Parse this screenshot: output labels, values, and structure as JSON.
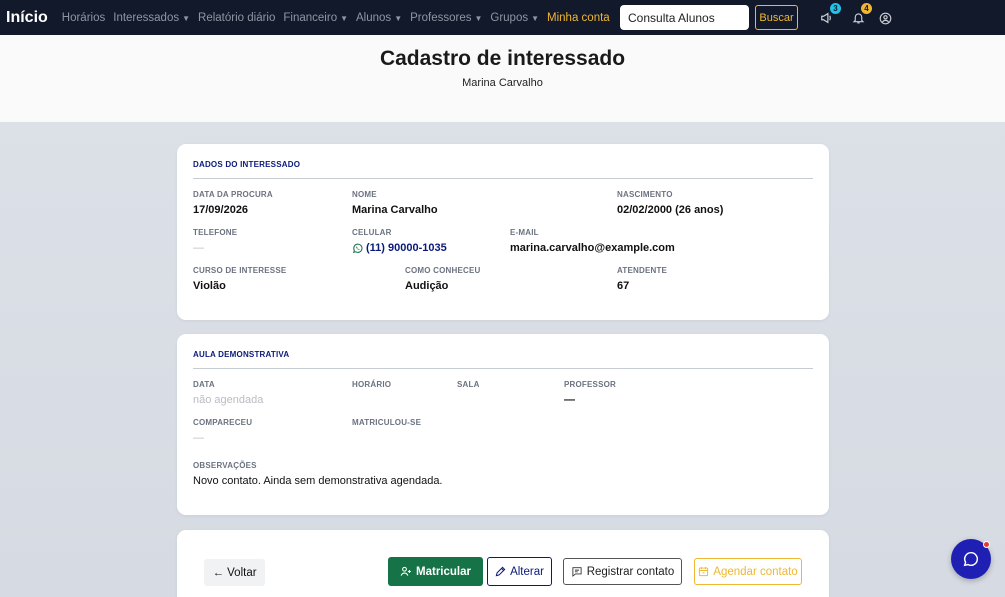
{
  "nav": {
    "brand": "Início",
    "items": [
      {
        "label": "Horários",
        "dropdown": false
      },
      {
        "label": "Interessados",
        "dropdown": true
      },
      {
        "label": "Relatório diário",
        "dropdown": false
      },
      {
        "label": "Financeiro",
        "dropdown": true
      },
      {
        "label": "Alunos",
        "dropdown": true
      },
      {
        "label": "Professores",
        "dropdown": true
      },
      {
        "label": "Grupos",
        "dropdown": true
      }
    ],
    "account_label": "Minha conta",
    "search_value": "Consulta Alunos",
    "search_button": "Buscar",
    "megaphone_badge": "3",
    "bell_badge": "4",
    "megaphone_badge_color": "#22c3e6",
    "bell_badge_color": "#f0b732",
    "icons": [
      "megaphone-icon",
      "bell-icon",
      "user-icon"
    ]
  },
  "header": {
    "title": "Cadastro de interessado",
    "subtitle": "Marina Carvalho"
  },
  "interested": {
    "section_title": "DADOS DO INTERESSADO",
    "fields": {
      "data_procura": {
        "label": "DATA DA PROCURA",
        "value": "17/09/2026"
      },
      "nome": {
        "label": "NOME",
        "value": "Marina Carvalho"
      },
      "nascimento": {
        "label": "NASCIMENTO",
        "value": "02/02/2000 (26 anos)"
      },
      "telefone": {
        "label": "TELEFONE",
        "value": "—"
      },
      "celular": {
        "label": "CELULAR",
        "value": "(11) 90000-1035"
      },
      "email": {
        "label": "E-MAIL",
        "value": "marina.carvalho@example.com"
      },
      "curso": {
        "label": "CURSO DE INTERESSE",
        "value": "Violão"
      },
      "como_conheceu": {
        "label": "COMO CONHECEU",
        "value": "Audição"
      },
      "atendente": {
        "label": "ATENDENTE",
        "value": "67"
      }
    }
  },
  "demo": {
    "section_title": "AULA DEMONSTRATIVA",
    "fields": {
      "data": {
        "label": "DATA",
        "value": "não agendada"
      },
      "horario": {
        "label": "HORÁRIO",
        "value": ""
      },
      "sala": {
        "label": "SALA",
        "value": ""
      },
      "professor": {
        "label": "PROFESSOR",
        "value": "—"
      },
      "compareceu": {
        "label": "COMPARECEU",
        "value": "—"
      },
      "matriculou": {
        "label": "MATRICULOU-SE",
        "value": ""
      },
      "observacoes": {
        "label": "OBSERVAÇÕES",
        "value": "Novo contato. Ainda sem demonstrativa agendada."
      }
    }
  },
  "actions": {
    "back": "← Voltar",
    "enroll": "Matricular",
    "edit": "Alterar",
    "register_contact": "Registrar contato",
    "schedule_contact": "Agendar contato"
  },
  "colors": {
    "navbar": "#11192b",
    "accent_gold": "#f0b732",
    "section_title": "#0a1a7a",
    "enroll_green": "#157347",
    "chat_fab": "#1f1fb4"
  }
}
